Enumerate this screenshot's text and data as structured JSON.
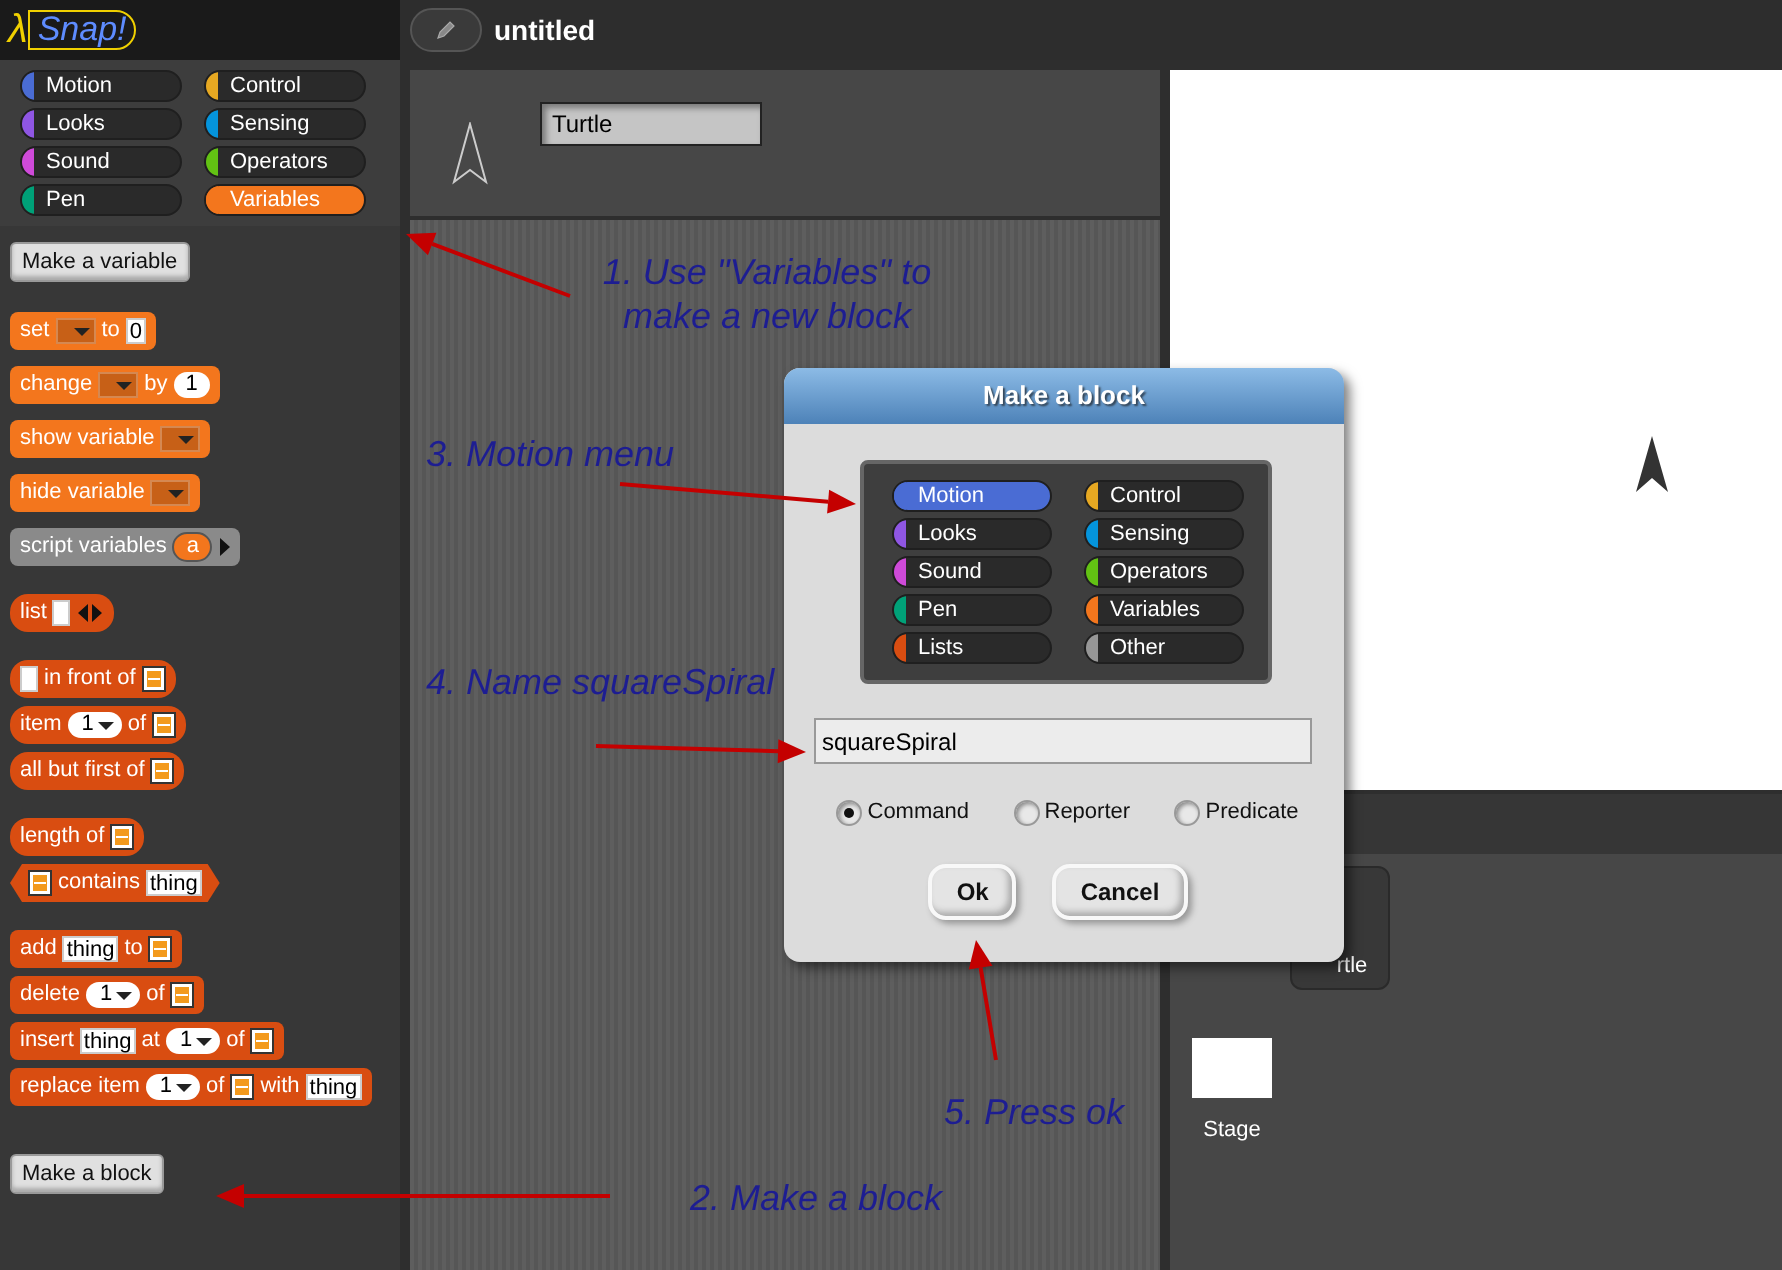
{
  "app": {
    "logo_symbol": "λ",
    "logo_text": "Snap!",
    "project_title": "untitled"
  },
  "categories": [
    {
      "label": "Motion",
      "color": "#4a6cd4",
      "selected": false
    },
    {
      "label": "Control",
      "color": "#e6a822",
      "selected": false
    },
    {
      "label": "Looks",
      "color": "#8f56e3",
      "selected": false
    },
    {
      "label": "Sensing",
      "color": "#0494dc",
      "selected": false
    },
    {
      "label": "Sound",
      "color": "#cf4ad9",
      "selected": false
    },
    {
      "label": "Operators",
      "color": "#62c213",
      "selected": false
    },
    {
      "label": "Pen",
      "color": "#00a178",
      "selected": false
    },
    {
      "label": "Variables",
      "color": "#f3761d",
      "selected": true
    }
  ],
  "palette": {
    "make_variable_button": "Make a variable",
    "make_block_button": "Make a block",
    "block_groups": [
      [
        {
          "kind": "command",
          "color": "#f3761d",
          "parts": [
            {
              "kind": "label",
              "text": "set"
            },
            {
              "kind": "dropdown"
            },
            {
              "kind": "label",
              "text": "to"
            },
            {
              "kind": "text-slot",
              "text": "0"
            }
          ]
        },
        {
          "kind": "command",
          "color": "#f3761d",
          "parts": [
            {
              "kind": "label",
              "text": "change"
            },
            {
              "kind": "dropdown"
            },
            {
              "kind": "label",
              "text": "by"
            },
            {
              "kind": "number-slot",
              "text": "1"
            }
          ]
        },
        {
          "kind": "command",
          "color": "#f3761d",
          "parts": [
            {
              "kind": "label",
              "text": "show variable"
            },
            {
              "kind": "dropdown"
            }
          ]
        },
        {
          "kind": "command",
          "color": "#f3761d",
          "parts": [
            {
              "kind": "label",
              "text": "hide variable"
            },
            {
              "kind": "dropdown"
            }
          ]
        },
        {
          "kind": "command",
          "color": "#8a8a8a",
          "parts": [
            {
              "kind": "label",
              "text": "script variables"
            },
            {
              "kind": "upvar",
              "text": "a"
            },
            {
              "kind": "expand-arrow"
            }
          ]
        }
      ],
      [
        {
          "kind": "reporter",
          "color": "#d94d11",
          "parts": [
            {
              "kind": "label",
              "text": "list"
            },
            {
              "kind": "text-slot"
            },
            {
              "kind": "arrows"
            }
          ]
        }
      ],
      [
        {
          "kind": "reporter",
          "color": "#d94d11",
          "parts": [
            {
              "kind": "text-slot"
            },
            {
              "kind": "label",
              "text": "in front of"
            },
            {
              "kind": "list-slot"
            }
          ]
        },
        {
          "kind": "reporter",
          "color": "#d94d11",
          "parts": [
            {
              "kind": "label",
              "text": "item"
            },
            {
              "kind": "number-menu",
              "text": "1"
            },
            {
              "kind": "label",
              "text": "of"
            },
            {
              "kind": "list-slot"
            }
          ]
        },
        {
          "kind": "reporter",
          "color": "#d94d11",
          "parts": [
            {
              "kind": "label",
              "text": "all but first of"
            },
            {
              "kind": "list-slot"
            }
          ]
        }
      ],
      [
        {
          "kind": "reporter",
          "color": "#d94d11",
          "parts": [
            {
              "kind": "label",
              "text": "length of"
            },
            {
              "kind": "list-slot"
            }
          ]
        },
        {
          "kind": "predicate",
          "color": "#d94d11",
          "parts": [
            {
              "kind": "list-slot"
            },
            {
              "kind": "label",
              "text": "contains"
            },
            {
              "kind": "text-slot",
              "text": "thing"
            }
          ]
        }
      ],
      [
        {
          "kind": "command",
          "color": "#d94d11",
          "parts": [
            {
              "kind": "label",
              "text": "add"
            },
            {
              "kind": "text-slot",
              "text": "thing"
            },
            {
              "kind": "label",
              "text": "to"
            },
            {
              "kind": "list-slot"
            }
          ]
        },
        {
          "kind": "command",
          "color": "#d94d11",
          "parts": [
            {
              "kind": "label",
              "text": "delete"
            },
            {
              "kind": "number-menu",
              "text": "1"
            },
            {
              "kind": "label",
              "text": "of"
            },
            {
              "kind": "list-slot"
            }
          ]
        },
        {
          "kind": "command",
          "color": "#d94d11",
          "parts": [
            {
              "kind": "label",
              "text": "insert"
            },
            {
              "kind": "text-slot",
              "text": "thing"
            },
            {
              "kind": "label",
              "text": "at"
            },
            {
              "kind": "number-menu",
              "text": "1"
            },
            {
              "kind": "label",
              "text": "of"
            },
            {
              "kind": "list-slot"
            }
          ]
        },
        {
          "kind": "command",
          "color": "#d94d11",
          "parts": [
            {
              "kind": "label",
              "text": "replace item"
            },
            {
              "kind": "number-menu",
              "text": "1"
            },
            {
              "kind": "label",
              "text": "of"
            },
            {
              "kind": "list-slot"
            },
            {
              "kind": "label",
              "text": "with"
            },
            {
              "kind": "text-slot",
              "text": "thing"
            }
          ]
        }
      ]
    ]
  },
  "sprite": {
    "name": "Turtle"
  },
  "corral": {
    "sprite_label": "rtle",
    "stage_label": "Stage"
  },
  "dialog": {
    "title": "Make a block",
    "categories": [
      {
        "label": "Motion",
        "color": "#4a6cd4",
        "selected": true
      },
      {
        "label": "Control",
        "color": "#e6a822",
        "selected": false
      },
      {
        "label": "Looks",
        "color": "#8f56e3",
        "selected": false
      },
      {
        "label": "Sensing",
        "color": "#0494dc",
        "selected": false
      },
      {
        "label": "Sound",
        "color": "#cf4ad9",
        "selected": false
      },
      {
        "label": "Operators",
        "color": "#62c213",
        "selected": false
      },
      {
        "label": "Pen",
        "color": "#00a178",
        "selected": false
      },
      {
        "label": "Variables",
        "color": "#f3761d",
        "selected": false
      },
      {
        "label": "Lists",
        "color": "#d94d11",
        "selected": false
      },
      {
        "label": "Other",
        "color": "#969696",
        "selected": false
      }
    ],
    "name_value": "squareSpiral",
    "block_types": [
      {
        "label": "Command",
        "selected": true
      },
      {
        "label": "Reporter",
        "selected": false
      },
      {
        "label": "Predicate",
        "selected": false
      }
    ],
    "ok_button": "Ok",
    "cancel_button": "Cancel"
  },
  "annotations": [
    {
      "text": "1. Use \"Variables\" to make a new block"
    },
    {
      "text": "2. Make a block"
    },
    {
      "text": "3. Motion menu"
    },
    {
      "text": "4. Name squareSpiral"
    },
    {
      "text": "5. Press ok"
    }
  ]
}
